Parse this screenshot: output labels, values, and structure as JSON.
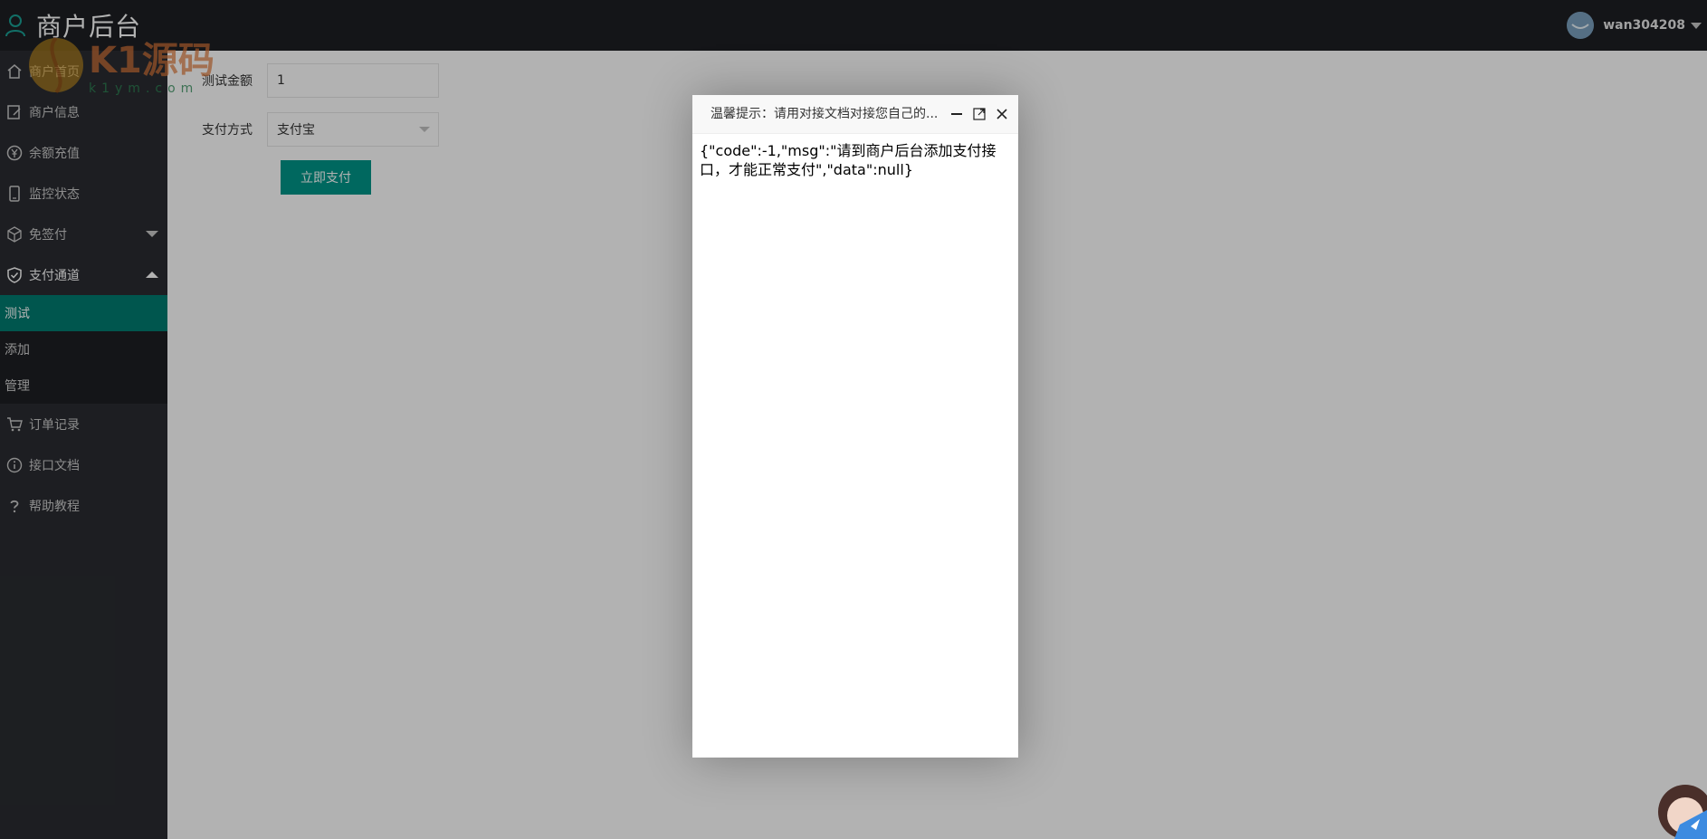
{
  "header": {
    "title": "商户后台",
    "username": "wan304208"
  },
  "watermark": {
    "big": "K1源码",
    "small": "k1ym.com"
  },
  "sidebar": {
    "items": [
      {
        "label": "商户首页",
        "icon": "home-icon"
      },
      {
        "label": "商户信息",
        "icon": "edit-icon"
      },
      {
        "label": "余额充值",
        "icon": "yen-icon"
      },
      {
        "label": "监控状态",
        "icon": "phone-icon"
      },
      {
        "label": "免签付",
        "icon": "cube-icon"
      },
      {
        "label": "支付通道",
        "icon": "shield-check-icon"
      },
      {
        "label": "订单记录",
        "icon": "cart-icon"
      },
      {
        "label": "接口文档",
        "icon": "info-icon"
      },
      {
        "label": "帮助教程",
        "icon": "question-icon"
      }
    ],
    "sub_items": [
      {
        "label": "测试",
        "active": true
      },
      {
        "label": "添加",
        "active": false
      },
      {
        "label": "管理",
        "active": false
      }
    ]
  },
  "form": {
    "amount_label": "测试金额",
    "amount_value": "1",
    "method_label": "支付方式",
    "method_value": "支付宝",
    "submit_label": "立即支付"
  },
  "dialog": {
    "title": "温馨提示：请用对接文档对接您自己的...",
    "body": "{\"code\":-1,\"msg\":\"请到商户后台添加支付接口，才能正常支付\",\"data\":null}"
  },
  "colors": {
    "accent": "#009688",
    "active_menu": "#007b70",
    "sidebar": "#2a2c31",
    "header": "#1d1f23"
  }
}
